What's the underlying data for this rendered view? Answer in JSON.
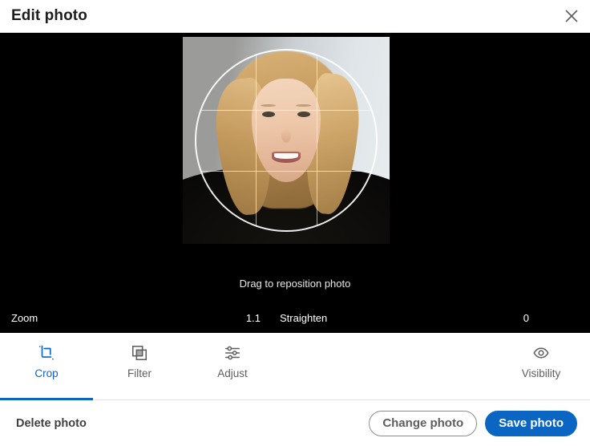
{
  "header": {
    "title": "Edit photo",
    "close_icon": "close-icon"
  },
  "editor": {
    "caption": "Drag to reposition photo",
    "crop_shape": "circle",
    "grid": "rule-of-thirds",
    "photo_alt": "portrait-photo"
  },
  "sliders": {
    "zoom": {
      "label": "Zoom",
      "value": "1.1",
      "fill_percent": 7
    },
    "straighten": {
      "label": "Straighten",
      "value": "0",
      "fill_percent": 50
    },
    "rotate_icon": "rotate-clockwise-icon"
  },
  "tabs": [
    {
      "label": "Crop",
      "icon": "crop-icon",
      "active": true
    },
    {
      "label": "Filter",
      "icon": "filter-icon",
      "active": false
    },
    {
      "label": "Adjust",
      "icon": "adjust-sliders-icon",
      "active": false
    }
  ],
  "visibility": {
    "label": "Visibility",
    "icon": "eye-icon"
  },
  "footer": {
    "delete_label": "Delete photo",
    "change_label": "Change photo",
    "save_label": "Save photo"
  },
  "colors": {
    "accent": "#0a66c2",
    "editor_bg": "#000000",
    "text_primary": "#1d1d1d",
    "text_muted": "#5e5e5e"
  }
}
